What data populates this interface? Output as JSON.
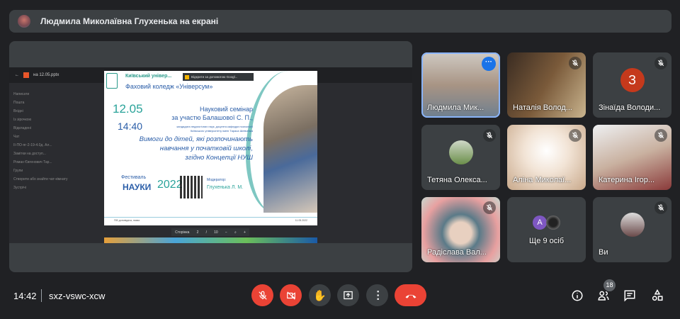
{
  "banner": {
    "text": "Людмила Миколаївна Глухенька на екрані"
  },
  "screen": {
    "tab": "на 12.05.pptx",
    "sidebar": [
      "Написати",
      "Пошта",
      "Вхідні",
      "Із зірочкою",
      "Відкладені",
      "Чат",
      "ІІ-ПО-пг-2-19-4.0д. Ал...",
      "Замітки на доступ...",
      "Роман Євгенович Тар...",
      "Групи",
      "Створити або знайти чат-кімнату",
      "Зустрічі"
    ],
    "popup": "Відкрити за допомогою Googl...",
    "slide": {
      "university": "Київський універ...",
      "college": "Фаховий коледж «Універсум»",
      "date": "12.05",
      "time": "14:40",
      "seminar": "Науковий семінар",
      "guest": "за участю Балашової С. П.,",
      "guest_info1": "кандидата педагогічних наук, доцента кафедри психології",
      "guest_info2": "Київського університету імені Тараса Шевченка",
      "topic": [
        "Вимоги до дітей, які розпочинають",
        "навчання у початковій школі,",
        "згідно Концепції НУШ"
      ],
      "festival": "Фестиваль",
      "nauky": "НАУКИ",
      "year": "2022",
      "moderator_label": "Модератор:",
      "moderator": "Глухенька Л. М.",
      "footer_left": "ПІБ доповідача, назва",
      "footer_right": "11.05.2022"
    },
    "pdf": {
      "page_label": "Сторінка",
      "page": "2",
      "sep": "/",
      "total": "10",
      "minus": "−",
      "plus": "+"
    }
  },
  "participants": [
    {
      "name": "Людмила Мик...",
      "selected": true,
      "bg": "linear-gradient(180deg,#cfcac3,#a89484 50%,#6e7f8f)"
    },
    {
      "name": "Наталія Волод...",
      "muted": true,
      "bg": "linear-gradient(120deg,#3a2c22,#7a5a3a 50%,#c9b48e)"
    },
    {
      "name": "Зінаїда Володи...",
      "muted": true,
      "initial": "З",
      "color": "#c5391c"
    },
    {
      "name": "Тетяна Олекса...",
      "muted": true,
      "avatar": "linear-gradient(#cfd8c8,#6b8f4a)"
    },
    {
      "name": "Аліна Миколаї...",
      "muted": true,
      "bg": "radial-gradient(circle at 50% 40%,#fff,#f2e4d6 40%,#c8a88a)"
    },
    {
      "name": "Катерина Ігор...",
      "muted": true,
      "bg": "linear-gradient(160deg,#eef0f2,#c9b1a0 50%,#8a3a3a)"
    },
    {
      "name": "Радіслава Вал...",
      "muted": true,
      "bg": "radial-gradient(circle at 50% 55%,#e8d0c0 20%,#5a7a88 35%,#e8a0a0 70%,#c7d8d0)"
    },
    {
      "name": "Ще 9 осіб",
      "others": true,
      "initial": "A",
      "color": "#7e57c2"
    },
    {
      "name": "Ви",
      "muted": true,
      "avatar": "linear-gradient(#ddd,#6a4a4a)"
    }
  ],
  "bottom": {
    "time": "14:42",
    "meeting_code": "sxz-vswc-xcw",
    "participants_count": "18"
  },
  "colors": {
    "bg": "#202124",
    "surface": "#3c4043",
    "danger": "#ea4335",
    "accent": "#1a73e8"
  }
}
